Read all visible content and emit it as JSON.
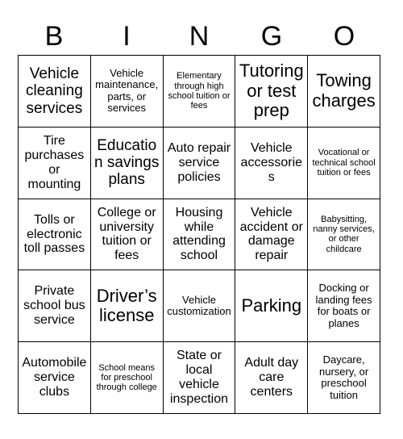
{
  "card": {
    "header_letters": [
      "B",
      "I",
      "N",
      "G",
      "O"
    ],
    "border_color": "#000000",
    "background_color": "#ffffff",
    "text_color": "#000000",
    "rows": 5,
    "columns": 5,
    "cells": [
      {
        "text": "Vehicle cleaning services",
        "size": "lg"
      },
      {
        "text": "Vehicle maintenance, parts, or services",
        "size": "sm"
      },
      {
        "text": "Elementary through high school tuition or fees",
        "size": "xs"
      },
      {
        "text": "Tutoring or test prep",
        "size": "xl"
      },
      {
        "text": "Towing charges",
        "size": "xl"
      },
      {
        "text": "Tire purchases or mounting",
        "size": "md"
      },
      {
        "text": "Education savings plans",
        "size": "lg"
      },
      {
        "text": "Auto repair service policies",
        "size": "md"
      },
      {
        "text": "Vehicle accessories",
        "size": "md"
      },
      {
        "text": "Vocational or technical school tuition or fees",
        "size": "xs"
      },
      {
        "text": "Tolls or electronic toll passes",
        "size": "md"
      },
      {
        "text": "College or university tuition or fees",
        "size": "md"
      },
      {
        "text": "Housing while attending school",
        "size": "md"
      },
      {
        "text": "Vehicle accident or damage repair",
        "size": "md"
      },
      {
        "text": "Babysitting, nanny services, or other childcare",
        "size": "xs"
      },
      {
        "text": "Private school bus service",
        "size": "md"
      },
      {
        "text": "Driver’s license",
        "size": "xl"
      },
      {
        "text": "Vehicle customization",
        "size": "sm"
      },
      {
        "text": "Parking",
        "size": "xl"
      },
      {
        "text": "Docking or landing fees for boats or planes",
        "size": "sm"
      },
      {
        "text": "Automobile service clubs",
        "size": "md"
      },
      {
        "text": "School means for preschool through college",
        "size": "xs"
      },
      {
        "text": "State or local vehicle inspection",
        "size": "md"
      },
      {
        "text": "Adult day care centers",
        "size": "md"
      },
      {
        "text": "Daycare, nursery, or preschool tuition",
        "size": "sm"
      }
    ]
  }
}
